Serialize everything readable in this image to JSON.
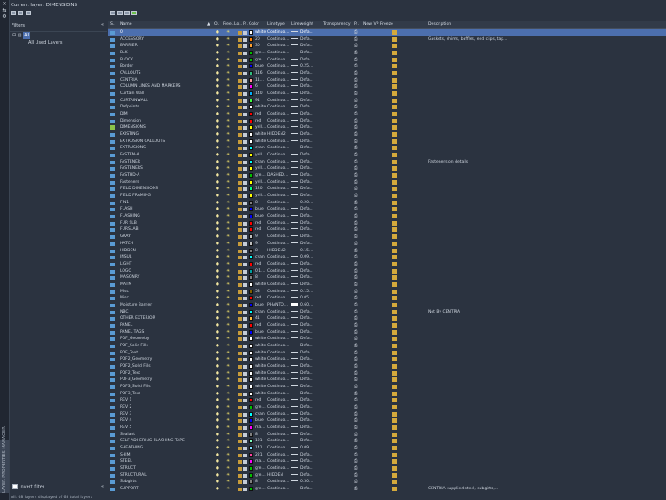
{
  "current_layer": "Current layer: DIMENSIONS",
  "panel_title": "LAYER PROPERTIES MANAGER",
  "filters": {
    "header": "Filters",
    "collapse_label": "«",
    "tree": [
      {
        "label": "All",
        "selected": true
      },
      {
        "label": "All Used Layers",
        "selected": false
      }
    ],
    "invert_label": "Invert filter"
  },
  "columns": [
    "S..",
    "Name",
    "O..",
    "Free..",
    "Lo..",
    "P..",
    "Color",
    "Linetype",
    "Lineweight",
    "Transparency",
    "P..",
    "New VP Freeze",
    "Description"
  ],
  "icons": {
    "on": "lightbulb-icon",
    "freeze": "sun-icon",
    "lock": "padlock-icon",
    "plot": "printer-icon",
    "vpfreeze": "vp-freeze-icon",
    "current": "checkmark-icon",
    "layer": "layer-stack-icon"
  },
  "rows": [
    {
      "name": "0",
      "color": "white",
      "hex": "#ffffff",
      "lt": "Continuo...",
      "lw": "Defa...",
      "desc": "",
      "sel": true
    },
    {
      "name": "ACCESSORY",
      "color": "20",
      "hex": "#ff7f00",
      "lt": "Continuo...",
      "lw": "Defa...",
      "desc": "Gaskets, shims, baffles, end clips, tap..."
    },
    {
      "name": "BARRIER",
      "color": "30",
      "hex": "#ff9f2f",
      "lt": "Continuo...",
      "lw": "Defa...",
      "desc": ""
    },
    {
      "name": "BLK",
      "color": "gre...",
      "hex": "#00c000",
      "lt": "Continuo...",
      "lw": "Defa...",
      "desc": ""
    },
    {
      "name": "BLOCK",
      "color": "gre...",
      "hex": "#00c000",
      "lt": "Continuo...",
      "lw": "Defa...",
      "desc": ""
    },
    {
      "name": "Border",
      "color": "blue",
      "hex": "#0000ff",
      "lt": "Continuo...",
      "lw": "0.25...",
      "desc": ""
    },
    {
      "name": "CALLOUTS",
      "color": "116",
      "hex": "#2fbf7f",
      "lt": "Continuo...",
      "lw": "Defa...",
      "desc": ""
    },
    {
      "name": "CENTRIA",
      "color": "11...",
      "hex": "#ff9f9f",
      "lt": "Continuo...",
      "lw": "Defa...",
      "desc": ""
    },
    {
      "name": "COLUMN LINES AND MARKERS",
      "color": "6",
      "hex": "#ff00ff",
      "lt": "Continuo...",
      "lw": "Defa...",
      "desc": ""
    },
    {
      "name": "Curtain Wall",
      "color": "140",
      "hex": "#00afff",
      "lt": "Continuo...",
      "lw": "Defa...",
      "desc": ""
    },
    {
      "name": "CURTAINWALL",
      "color": "91",
      "hex": "#3fff3f",
      "lt": "Continuo...",
      "lw": "Defa...",
      "desc": ""
    },
    {
      "name": "Defpoints",
      "color": "white",
      "hex": "#ffffff",
      "lt": "Continuo...",
      "lw": "Defa...",
      "desc": ""
    },
    {
      "name": "DIM",
      "color": "red",
      "hex": "#ff0000",
      "lt": "Continuo...",
      "lw": "Defa...",
      "desc": ""
    },
    {
      "name": "Dimension",
      "color": "red",
      "hex": "#ff0000",
      "lt": "Continuo...",
      "lw": "Defa...",
      "desc": ""
    },
    {
      "name": "DIMENSIONS",
      "color": "yell...",
      "hex": "#ffff00",
      "lt": "Continuo...",
      "lw": "Defa...",
      "desc": "",
      "cur": true
    },
    {
      "name": "EXISTING",
      "color": "white",
      "hex": "#ffffff",
      "lt": "HIDDEN2",
      "lw": "Defa...",
      "desc": ""
    },
    {
      "name": "EXTRUSION CALLOUTS",
      "color": "white",
      "hex": "#ffffff",
      "lt": "Continuo...",
      "lw": "Defa...",
      "desc": ""
    },
    {
      "name": "EXTRUSIONS",
      "color": "cyan",
      "hex": "#00ffff",
      "lt": "Continuo...",
      "lw": "Defa...",
      "desc": ""
    },
    {
      "name": "FASTEN-A",
      "color": "yell...",
      "hex": "#ffff00",
      "lt": "Continuo...",
      "lw": "Defa...",
      "desc": ""
    },
    {
      "name": "FASTENER",
      "color": "cyan",
      "hex": "#00ffff",
      "lt": "Continuo...",
      "lw": "Defa...",
      "desc": "Fasteners on details"
    },
    {
      "name": "FASTENERS",
      "color": "yell...",
      "hex": "#ffff00",
      "lt": "Continuo...",
      "lw": "Defa...",
      "desc": ""
    },
    {
      "name": "FASTHD-A",
      "color": "gre...",
      "hex": "#00c000",
      "lt": "DASHED...",
      "lw": "Defa...",
      "desc": ""
    },
    {
      "name": "Fasteners",
      "color": "yell...",
      "hex": "#ffff00",
      "lt": "Continuo...",
      "lw": "Defa...",
      "desc": ""
    },
    {
      "name": "FIELD DIMENSIONS",
      "color": "120",
      "hex": "#00ff7f",
      "lt": "Continuo...",
      "lw": "Defa...",
      "desc": ""
    },
    {
      "name": "FIELD FRAMING",
      "color": "yell...",
      "hex": "#ffff00",
      "lt": "Continuo...",
      "lw": "Defa...",
      "desc": ""
    },
    {
      "name": "FIN1",
      "color": "8",
      "hex": "#808080",
      "lt": "Continuo...",
      "lw": "0.20...",
      "desc": ""
    },
    {
      "name": "FLASH",
      "color": "blue",
      "hex": "#0000ff",
      "lt": "Continuo...",
      "lw": "Defa...",
      "desc": ""
    },
    {
      "name": "FLASHING",
      "color": "blue",
      "hex": "#0000ff",
      "lt": "Continuo...",
      "lw": "Defa...",
      "desc": ""
    },
    {
      "name": "FUR SLB",
      "color": "red",
      "hex": "#ff0000",
      "lt": "Continuo...",
      "lw": "Defa...",
      "desc": ""
    },
    {
      "name": "FURSLAB",
      "color": "red",
      "hex": "#ff0000",
      "lt": "Continuo...",
      "lw": "Defa...",
      "desc": ""
    },
    {
      "name": "GRAY",
      "color": "9",
      "hex": "#c0c0c0",
      "lt": "Continuo...",
      "lw": "Defa...",
      "desc": ""
    },
    {
      "name": "HATCH",
      "color": "9",
      "hex": "#c0c0c0",
      "lt": "Continuo...",
      "lw": "Defa...",
      "desc": ""
    },
    {
      "name": "HIDDEN",
      "color": "8",
      "hex": "#808080",
      "lt": "HIDDEN2",
      "lw": "0.15...",
      "desc": ""
    },
    {
      "name": "INSUL",
      "color": "cyan",
      "hex": "#00ffff",
      "lt": "Continuo...",
      "lw": "0.09...",
      "desc": ""
    },
    {
      "name": "LIGHT",
      "color": "red",
      "hex": "#ff0000",
      "lt": "Continuo...",
      "lw": "Defa...",
      "desc": ""
    },
    {
      "name": "LOGO",
      "color": "0.1...",
      "hex": "#00a0a0",
      "lt": "Continuo...",
      "lw": "Defa...",
      "desc": ""
    },
    {
      "name": "MASONRY",
      "color": "8",
      "hex": "#808080",
      "lt": "Continuo...",
      "lw": "Defa...",
      "desc": ""
    },
    {
      "name": "MATM",
      "color": "white",
      "hex": "#ffffff",
      "lt": "Continuo...",
      "lw": "Defa...",
      "desc": ""
    },
    {
      "name": "Misc",
      "color": "53",
      "hex": "#7f5f00",
      "lt": "Continuo...",
      "lw": "0.15...",
      "desc": ""
    },
    {
      "name": "Misc.",
      "color": "red",
      "hex": "#ff0000",
      "lt": "Continuo...",
      "lw": "0.05...",
      "desc": ""
    },
    {
      "name": "Moisture Barrier",
      "color": "blue",
      "hex": "#0000ff",
      "lt": "PHANTO...",
      "lw": "0.60...",
      "desc": "",
      "thick": true
    },
    {
      "name": "NBC",
      "color": "cyan",
      "hex": "#00ffff",
      "lt": "Continuo...",
      "lw": "Defa...",
      "desc": "Not By CENTRIA"
    },
    {
      "name": "OTHER EXTERIOR",
      "color": "41",
      "hex": "#ffbf3f",
      "lt": "Continuo...",
      "lw": "Defa...",
      "desc": ""
    },
    {
      "name": "PANEL",
      "color": "red",
      "hex": "#ff0000",
      "lt": "Continuo...",
      "lw": "Defa...",
      "desc": ""
    },
    {
      "name": "PANEL TAGS",
      "color": "blue",
      "hex": "#0000ff",
      "lt": "Continuo...",
      "lw": "Defa...",
      "desc": ""
    },
    {
      "name": "PDF_Geometry",
      "color": "white",
      "hex": "#ffffff",
      "lt": "Continuo...",
      "lw": "Defa...",
      "desc": ""
    },
    {
      "name": "PDF_Solid Fills",
      "color": "white",
      "hex": "#ffffff",
      "lt": "Continuo...",
      "lw": "Defa...",
      "desc": ""
    },
    {
      "name": "PDF_Text",
      "color": "white",
      "hex": "#ffffff",
      "lt": "Continuo...",
      "lw": "Defa...",
      "desc": ""
    },
    {
      "name": "PDF2_Geometry",
      "color": "white",
      "hex": "#ffffff",
      "lt": "Continuo...",
      "lw": "Defa...",
      "desc": ""
    },
    {
      "name": "PDF2_Solid Fills",
      "color": "white",
      "hex": "#ffffff",
      "lt": "Continuo...",
      "lw": "Defa...",
      "desc": ""
    },
    {
      "name": "PDF2_Text",
      "color": "white",
      "hex": "#ffffff",
      "lt": "Continuo...",
      "lw": "Defa...",
      "desc": ""
    },
    {
      "name": "PDF3_Geometry",
      "color": "white",
      "hex": "#ffffff",
      "lt": "Continuo...",
      "lw": "Defa...",
      "desc": ""
    },
    {
      "name": "PDF3_Solid Fills",
      "color": "white",
      "hex": "#ffffff",
      "lt": "Continuo...",
      "lw": "Defa...",
      "desc": ""
    },
    {
      "name": "PDF3_Text",
      "color": "white",
      "hex": "#ffffff",
      "lt": "Continuo...",
      "lw": "Defa...",
      "desc": ""
    },
    {
      "name": "REV 1",
      "color": "red",
      "hex": "#ff0000",
      "lt": "Continuo...",
      "lw": "Defa...",
      "desc": ""
    },
    {
      "name": "REV 2",
      "color": "gre...",
      "hex": "#00c000",
      "lt": "Continuo...",
      "lw": "Defa...",
      "desc": ""
    },
    {
      "name": "REV 3",
      "color": "cyan",
      "hex": "#00ffff",
      "lt": "Continuo...",
      "lw": "Defa...",
      "desc": ""
    },
    {
      "name": "REV 4",
      "color": "blue",
      "hex": "#0000ff",
      "lt": "Continuo...",
      "lw": "Defa...",
      "desc": ""
    },
    {
      "name": "REV 5",
      "color": "ma...",
      "hex": "#ff00ff",
      "lt": "Continuo...",
      "lw": "Defa...",
      "desc": ""
    },
    {
      "name": "Sealant",
      "color": "8",
      "hex": "#808080",
      "lt": "Continuo...",
      "lw": "Defa...",
      "desc": ""
    },
    {
      "name": "SELF ADHERING FLASHING TAPE",
      "color": "121",
      "hex": "#7fffbf",
      "lt": "Continuo...",
      "lw": "Defa...",
      "desc": ""
    },
    {
      "name": "SHEATHING",
      "color": "141",
      "hex": "#7fdfff",
      "lt": "Continuo...",
      "lw": "0.09...",
      "desc": ""
    },
    {
      "name": "SHIM",
      "color": "221",
      "hex": "#ff3f9f",
      "lt": "Continuo...",
      "lw": "Defa...",
      "desc": ""
    },
    {
      "name": "STEEL",
      "color": "ma...",
      "hex": "#ff00ff",
      "lt": "Continuo...",
      "lw": "Defa...",
      "desc": ""
    },
    {
      "name": "STRUCT",
      "color": "gre...",
      "hex": "#00c000",
      "lt": "Continuo...",
      "lw": "Defa...",
      "desc": ""
    },
    {
      "name": "STRUCTURAL",
      "color": "gre...",
      "hex": "#00c000",
      "lt": "HIDDEN",
      "lw": "Defa...",
      "desc": ""
    },
    {
      "name": "Subgirts",
      "color": "8",
      "hex": "#808080",
      "lt": "Continuo...",
      "lw": "0.30...",
      "desc": ""
    },
    {
      "name": "SUPPORT",
      "color": "gre...",
      "hex": "#00c000",
      "lt": "Continuo...",
      "lw": "Defa...",
      "desc": "CENTRIA supplied steel, subgirts,..."
    }
  ],
  "status": "All: 68 layers displayed of 68 total layers"
}
